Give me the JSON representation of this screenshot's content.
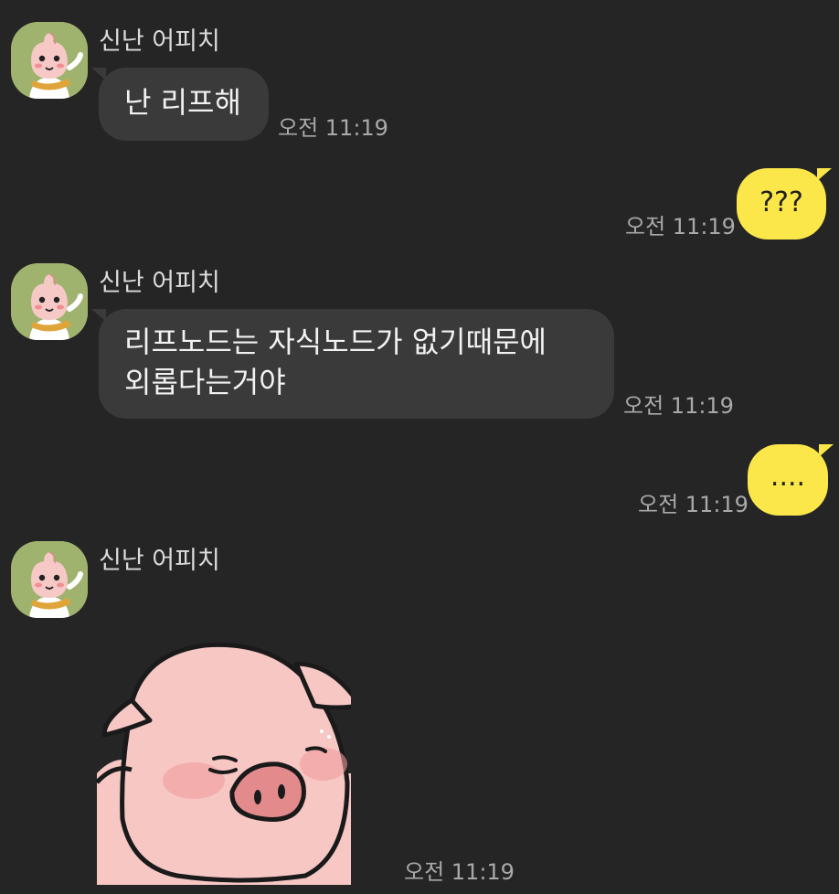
{
  "messages": [
    {
      "direction": "in",
      "sender": "신난 어피치",
      "text": "난 리프해",
      "time": "오전 11:19"
    },
    {
      "direction": "out",
      "text": "???",
      "time": "오전 11:19"
    },
    {
      "direction": "in",
      "sender": "신난 어피치",
      "lines": [
        "리프노드는 자식노드가 없기때문에",
        "외롭다는거야"
      ],
      "time": "오전 11:19"
    },
    {
      "direction": "out",
      "text": "....",
      "time": "오전 11:19"
    },
    {
      "direction": "in",
      "sender": "신난 어피치",
      "sticker": "sleepy-pig-sticker",
      "time": "오전 11:19"
    }
  ],
  "colors": {
    "background": "#252525",
    "incoming_bubble": "#3a3a3a",
    "outgoing_bubble": "#fbe74a",
    "avatar_bg": "#9fb36f",
    "pig_skin": "#f7c7c4"
  }
}
